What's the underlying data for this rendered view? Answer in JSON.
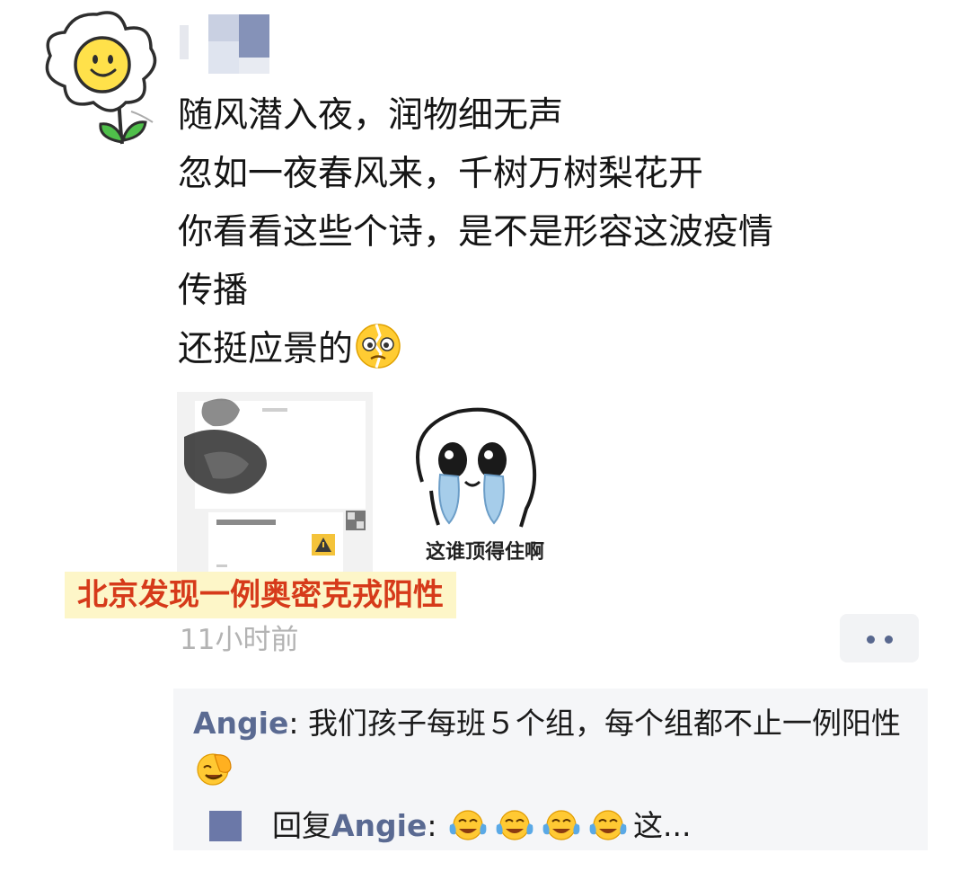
{
  "post": {
    "lines": [
      "随风潜入夜，润物细无声",
      "忽如一夜春风来，千树万树梨花开",
      "你看看这些个诗，是不是形容这波疫情",
      "传播",
      "还挺应景的"
    ],
    "line5_emoji": "broken-heart-face-emoji"
  },
  "images": {
    "image1_label": "北京发现一例奥密克戎阳性",
    "image2_caption": "这谁顶得住啊"
  },
  "meta": {
    "time": "11小时前",
    "more_icon": "more-dots-icon"
  },
  "comments": [
    {
      "user": "Angie",
      "separator": ": ",
      "text": "我们孩子每班５个组，每个组都不止一例阳性",
      "emoji": "facepalm-laugh-emoji"
    },
    {
      "reply_prefix": "回复",
      "user": "Angie",
      "separator": ": ",
      "emoji": "tears-of-joy-emoji",
      "emoji_count": 4,
      "text": "这..."
    }
  ],
  "colors": {
    "username": "#5a6a92",
    "highlight_text": "#d63a1a",
    "highlight_bg": "#fdf6c8",
    "timestamp": "#b3b3b3",
    "comment_bg": "#f5f6f8"
  }
}
